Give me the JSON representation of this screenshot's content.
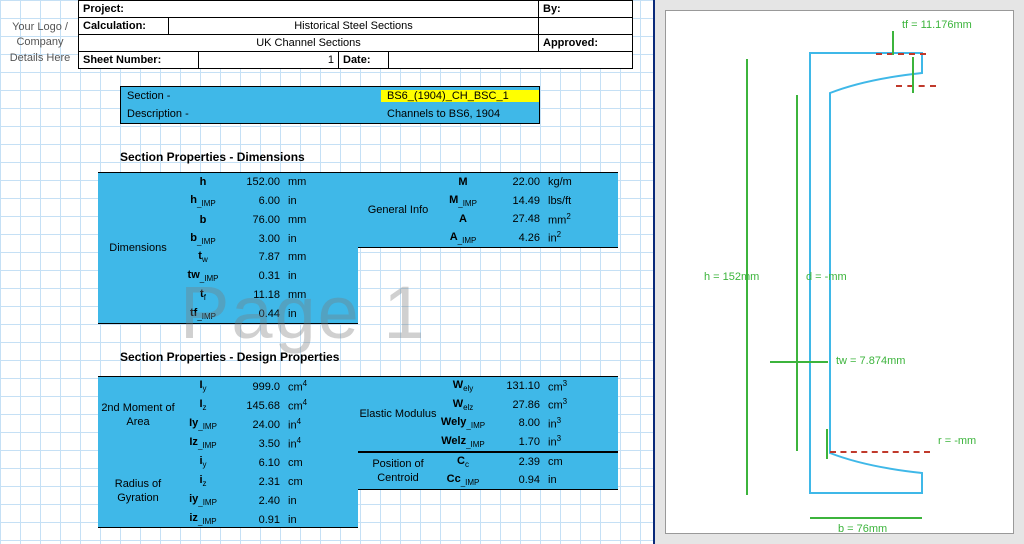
{
  "header": {
    "project_label": "Project:",
    "by_label": "By:",
    "calculation_label": "Calculation:",
    "calculation_value": "Historical Steel Sections",
    "subtitle": "UK Channel Sections",
    "approved_label": "Approved:",
    "sheet_number_label": "Sheet Number:",
    "sheet_number_value": "1",
    "date_label": "Date:"
  },
  "logo_placeholder": "Your Logo / Company Details Here",
  "section_info": {
    "section_label": "Section -",
    "section_value": "BS6_(1904)_CH_BSC_1",
    "description_label": "Description -",
    "description_value": "Channels to BS6, 1904"
  },
  "headings": {
    "dimensions": "Section Properties - Dimensions",
    "design": "Section Properties - Design Properties"
  },
  "watermark": "Page 1",
  "dimensions_block": {
    "label": "Dimensions",
    "rows": [
      {
        "sym": "h",
        "val": "152.00",
        "unit": "mm"
      },
      {
        "sym": "h_IMP",
        "val": "6.00",
        "unit": "in"
      },
      {
        "sym": "b",
        "val": "76.00",
        "unit": "mm"
      },
      {
        "sym": "b_IMP",
        "val": "3.00",
        "unit": "in"
      },
      {
        "sym": "tw",
        "val": "7.87",
        "unit": "mm"
      },
      {
        "sym": "tw_IMP",
        "val": "0.31",
        "unit": "in"
      },
      {
        "sym": "tf",
        "val": "11.18",
        "unit": "mm"
      },
      {
        "sym": "tf_IMP",
        "val": "0.44",
        "unit": "in"
      }
    ]
  },
  "general_info": {
    "label": "General Info",
    "rows": [
      {
        "sym": "M",
        "val": "22.00",
        "unit": "kg/m"
      },
      {
        "sym": "M_IMP",
        "val": "14.49",
        "unit": "lbs/ft"
      },
      {
        "sym": "A",
        "val": "27.48",
        "unit": "mm²"
      },
      {
        "sym": "A_IMP",
        "val": "4.26",
        "unit": "in²"
      }
    ]
  },
  "second_moment": {
    "label": "2nd Moment of Area",
    "rows": [
      {
        "sym": "Iy",
        "val": "999.0",
        "unit": "cm⁴"
      },
      {
        "sym": "Iz",
        "val": "145.68",
        "unit": "cm⁴"
      },
      {
        "sym": "Iy_IMP",
        "val": "24.00",
        "unit": "in⁴"
      },
      {
        "sym": "Iz_IMP",
        "val": "3.50",
        "unit": "in⁴"
      }
    ]
  },
  "radius_gyration": {
    "label": "Radius of Gyration",
    "rows": [
      {
        "sym": "iy",
        "val": "6.10",
        "unit": "cm"
      },
      {
        "sym": "iz",
        "val": "2.31",
        "unit": "cm"
      },
      {
        "sym": "iy_IMP",
        "val": "2.40",
        "unit": "in"
      },
      {
        "sym": "iz_IMP",
        "val": "0.91",
        "unit": "in"
      }
    ]
  },
  "elastic_modulus": {
    "label": "Elastic Modulus",
    "rows": [
      {
        "sym": "Wely",
        "val": "131.10",
        "unit": "cm³"
      },
      {
        "sym": "Welz",
        "val": "27.86",
        "unit": "cm³"
      },
      {
        "sym": "Wely_IMP",
        "val": "8.00",
        "unit": "in³"
      },
      {
        "sym": "Welz_IMP",
        "val": "1.70",
        "unit": "in³"
      }
    ]
  },
  "centroid": {
    "label": "Position of Centroid",
    "rows": [
      {
        "sym": "Cc",
        "val": "2.39",
        "unit": "cm"
      },
      {
        "sym": "Cc_IMP",
        "val": "0.94",
        "unit": "in"
      }
    ]
  },
  "diagram": {
    "tf": "tf = 11.176mm",
    "h": "h = 152mm",
    "d": "d = -mm",
    "tw": "tw = 7.874mm",
    "r": "r = -mm",
    "b": "b = 76mm"
  },
  "chart_data": {
    "type": "table",
    "title": "UK Channel Section BS6_(1904)_CH_BSC_1 Properties",
    "parameters": [
      {
        "name": "h",
        "value": 152.0,
        "unit": "mm",
        "imperial": 6.0,
        "imp_unit": "in"
      },
      {
        "name": "b",
        "value": 76.0,
        "unit": "mm",
        "imperial": 3.0,
        "imp_unit": "in"
      },
      {
        "name": "tw",
        "value": 7.87,
        "unit": "mm",
        "imperial": 0.31,
        "imp_unit": "in"
      },
      {
        "name": "tf",
        "value": 11.18,
        "unit": "mm",
        "imperial": 0.44,
        "imp_unit": "in"
      },
      {
        "name": "M",
        "value": 22.0,
        "unit": "kg/m",
        "imperial": 14.49,
        "imp_unit": "lbs/ft"
      },
      {
        "name": "A",
        "value": 27.48,
        "unit": "mm2",
        "imperial": 4.26,
        "imp_unit": "in2"
      },
      {
        "name": "Iy",
        "value": 999.0,
        "unit": "cm4",
        "imperial": 24.0,
        "imp_unit": "in4"
      },
      {
        "name": "Iz",
        "value": 145.68,
        "unit": "cm4",
        "imperial": 3.5,
        "imp_unit": "in4"
      },
      {
        "name": "iy",
        "value": 6.1,
        "unit": "cm",
        "imperial": 2.4,
        "imp_unit": "in"
      },
      {
        "name": "iz",
        "value": 2.31,
        "unit": "cm",
        "imperial": 0.91,
        "imp_unit": "in"
      },
      {
        "name": "Wely",
        "value": 131.1,
        "unit": "cm3",
        "imperial": 8.0,
        "imp_unit": "in3"
      },
      {
        "name": "Welz",
        "value": 27.86,
        "unit": "cm3",
        "imperial": 1.7,
        "imp_unit": "in3"
      },
      {
        "name": "Cc",
        "value": 2.39,
        "unit": "cm",
        "imperial": 0.94,
        "imp_unit": "in"
      }
    ]
  }
}
